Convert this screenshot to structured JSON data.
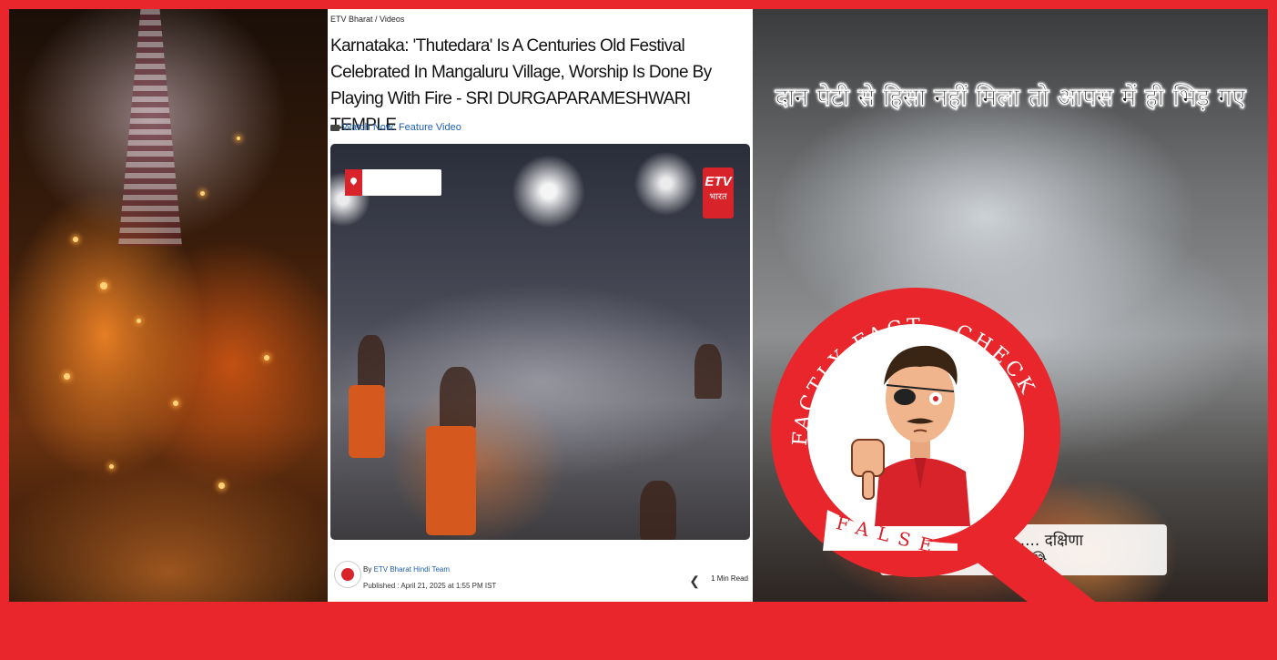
{
  "article": {
    "breadcrumb": "ETV Bharat  /  Videos",
    "headline": "Karnataka: 'Thutedara' Is A Centuries Old Festival Celebrated In Mangaluru Village, Worship Is Done By Playing With Fire - SRI DURGAPARAMESHWARI TEMPLE",
    "watch_label": "Watch Now: Feature Video",
    "video_logo_mark": "ETV",
    "video_logo_text": "भारत",
    "byline_prefix": "By ",
    "author": "ETV Bharat Hindi Team",
    "published": "Published : April 21, 2025 at 1:55 PM IST",
    "read_time": "1 Min Read"
  },
  "right_photo": {
    "caption": "दान पेटी से हिसा नहीं मिला तो आपस में ही भिड़ गए",
    "sub_caption_line1": "जो मांगा ..... दक्षिणा",
    "sub_caption_line2": "का है😂"
  },
  "stamp": {
    "arc_text": "FACTLY FACT - CHECK",
    "verdict": "FALSE",
    "color": "#e8262b"
  },
  "colors": {
    "border": "#e8262b",
    "link": "#1e5fb3"
  }
}
